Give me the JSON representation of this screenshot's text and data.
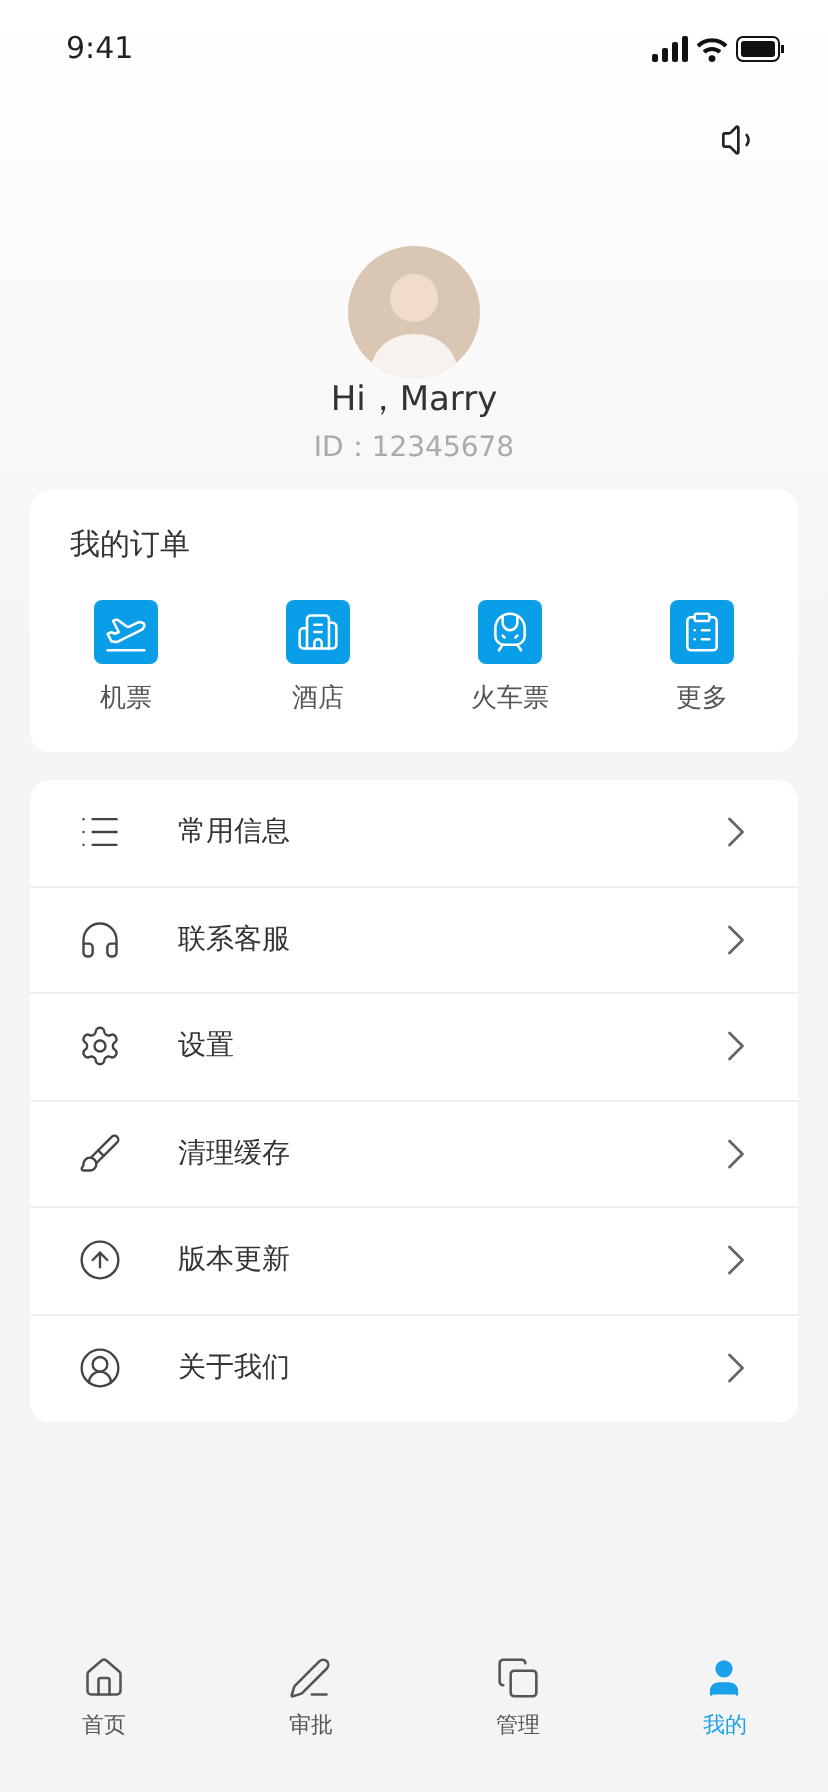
{
  "status_bar": {
    "time": "9:41"
  },
  "profile": {
    "greeting": "Hi，Marry",
    "id": "ID：12345678"
  },
  "orders": {
    "title": "我的订单",
    "items": [
      {
        "label": "机票"
      },
      {
        "label": "酒店"
      },
      {
        "label": "火车票"
      },
      {
        "label": "更多"
      }
    ]
  },
  "menu": [
    {
      "label": "常用信息"
    },
    {
      "label": "联系客服"
    },
    {
      "label": "设置"
    },
    {
      "label": "清理缓存"
    },
    {
      "label": "版本更新"
    },
    {
      "label": "关于我们"
    }
  ],
  "tabs": [
    {
      "label": "首页",
      "selected": false
    },
    {
      "label": "审批",
      "selected": false
    },
    {
      "label": "管理",
      "selected": false
    },
    {
      "label": "我的",
      "selected": true
    }
  ]
}
